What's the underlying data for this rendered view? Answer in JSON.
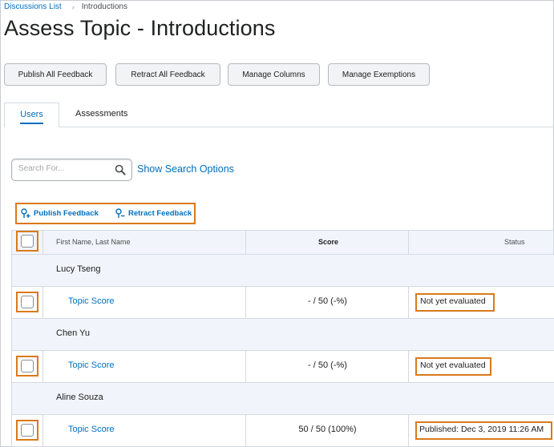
{
  "breadcrumb": {
    "link": "Discussions List",
    "separator": "›",
    "current": "Introductions"
  },
  "page_title": "Assess Topic - Introductions",
  "toolbar": {
    "publish_all": "Publish All Feedback",
    "retract_all": "Retract All Feedback",
    "manage_columns": "Manage Columns",
    "manage_exemptions": "Manage Exemptions"
  },
  "tabs": [
    {
      "label": "Users",
      "active": true
    },
    {
      "label": "Assessments",
      "active": false
    }
  ],
  "search": {
    "placeholder": "Search For...",
    "value": "",
    "options_link": "Show Search Options"
  },
  "feedback_actions": {
    "publish": "Publish Feedback",
    "retract": "Retract Feedback"
  },
  "table": {
    "headers": {
      "name": "First Name, Last Name",
      "score": "Score",
      "status": "Status"
    },
    "users": [
      {
        "name": "Lucy Tseng",
        "item": "Topic Score",
        "score": "- / 50 (-%)",
        "status": "Not yet evaluated"
      },
      {
        "name": "Chen Yu",
        "item": "Topic Score",
        "score": "- / 50 (-%)",
        "status": "Not yet evaluated"
      },
      {
        "name": "Aline Souza",
        "item": "Topic Score",
        "score": "50 / 50 (100%)",
        "status": "Published: Dec 3, 2019 11:26 AM"
      }
    ]
  },
  "colors": {
    "link": "#006fbf",
    "highlight": "#d97a1a",
    "header_bg": "#f1f5fb",
    "border": "#d3d9e3"
  },
  "icons": {
    "search": "magnifier-icon",
    "publish": "publish-feedback-icon",
    "retract": "retract-feedback-icon"
  }
}
